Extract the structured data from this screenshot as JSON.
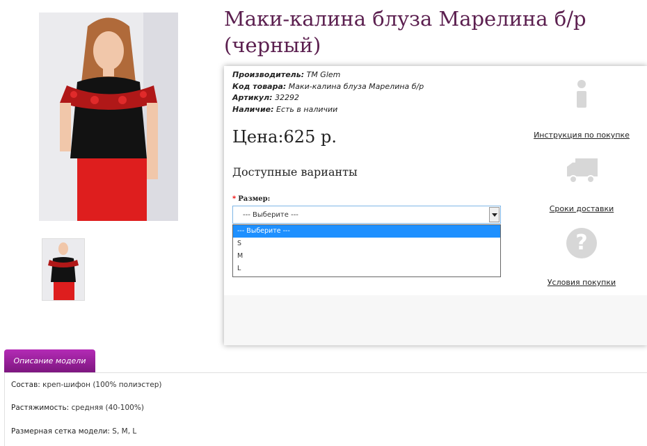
{
  "product": {
    "title": "Маки-калина блуза Марелина б/р (черный)",
    "main_image_alt": "Model wearing black blouse with red floral ruffle",
    "thumb_alt": "thumbnail"
  },
  "meta": {
    "manufacturer_label": "Производитель:",
    "manufacturer_value": "TM Glem",
    "code_label": "Код товара:",
    "code_value": "Маки-калина блуза Марелина б/р",
    "sku_label": "Артикул:",
    "sku_value": "32292",
    "stock_label": "Наличие:",
    "stock_value": "Есть в наличии"
  },
  "price": "Цена:625 р.",
  "variants_heading": "Доступные варианты",
  "size": {
    "required_mark": "*",
    "label": "Размер:",
    "selected": "--- Выберите ---",
    "options": [
      "--- Выберите ---",
      "S",
      "M",
      "L"
    ]
  },
  "sidebar": {
    "instructions": "Инструкция по покупке",
    "delivery": "Сроки доставки",
    "terms": "Условия покупки",
    "help_glyph": "?"
  },
  "tabs": {
    "description": "Описание модели"
  },
  "description": {
    "composition_label": "Состав:",
    "composition_value": "креп-шифон (100% полиэстер)",
    "stretch_label": "Растяжимость:",
    "stretch_value": "средняя (40-100%)",
    "sizes_label": "Размерная сетка модели:",
    "sizes_value": "S, M, L"
  },
  "colors": {
    "title": "#5b1f4f",
    "tab": "#9b209d",
    "option_selected": "#1e90ff",
    "icons": "#d7d7d7"
  }
}
